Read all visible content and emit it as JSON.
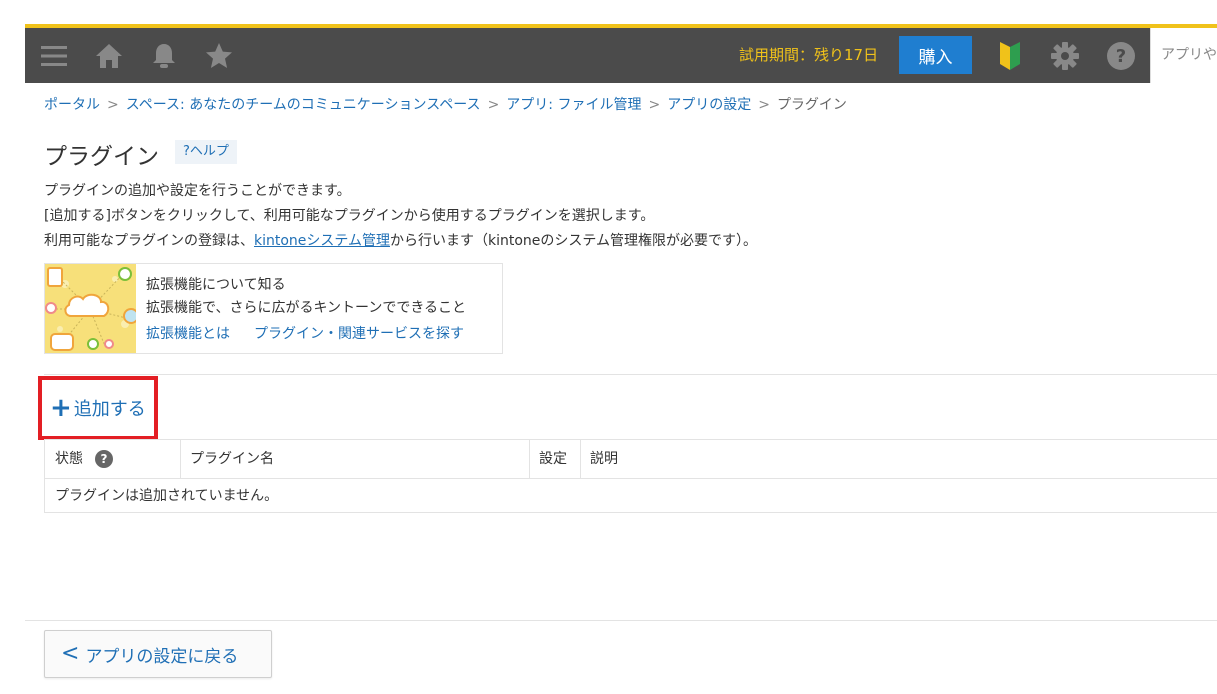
{
  "header": {
    "trial_text": "試用期間：残り17日",
    "buy_label": "購入",
    "search_placeholder": "アプリや",
    "icons": [
      "menu-icon",
      "home-icon",
      "bell-icon",
      "star-icon",
      "beginner-icon",
      "gear-icon",
      "help-icon"
    ],
    "colors": {
      "bar": "#4b4b4b",
      "accent": "#f0c21a",
      "buy": "#1f7ed0"
    }
  },
  "breadcrumb": {
    "items": [
      "ポータル",
      "スペース: あなたのチームのコミュニケーションスペース",
      "アプリ: ファイル管理",
      "アプリの設定"
    ],
    "separator": ">",
    "current": "プラグイン"
  },
  "page": {
    "title": "プラグイン",
    "help_label": "?ヘルプ"
  },
  "description": {
    "line1": "プラグインの追加や設定を行うことができます。",
    "line2": "[追加する]ボタンをクリックして、利用可能なプラグインから使用するプラグインを選択します。",
    "line3_before": "利用可能なプラグインの登録は、",
    "line3_link": "kintoneシステム管理",
    "line3_after": "から行います（kintoneのシステム管理権限が必要です）。"
  },
  "extension": {
    "title": "拡張機能について知る",
    "subtitle": "拡張機能で、さらに広がるキントーンでできること",
    "link1": "拡張機能とは",
    "link2": "プラグイン・関連サービスを探す"
  },
  "add_button": {
    "plus": "+",
    "label": "追加する"
  },
  "table": {
    "columns": [
      "状態",
      "プラグイン名",
      "設定",
      "説明"
    ],
    "help_mark": "?",
    "empty_message": "プラグインは追加されていません。"
  },
  "footer": {
    "chevron": "<",
    "back_label": "アプリの設定に戻る"
  }
}
